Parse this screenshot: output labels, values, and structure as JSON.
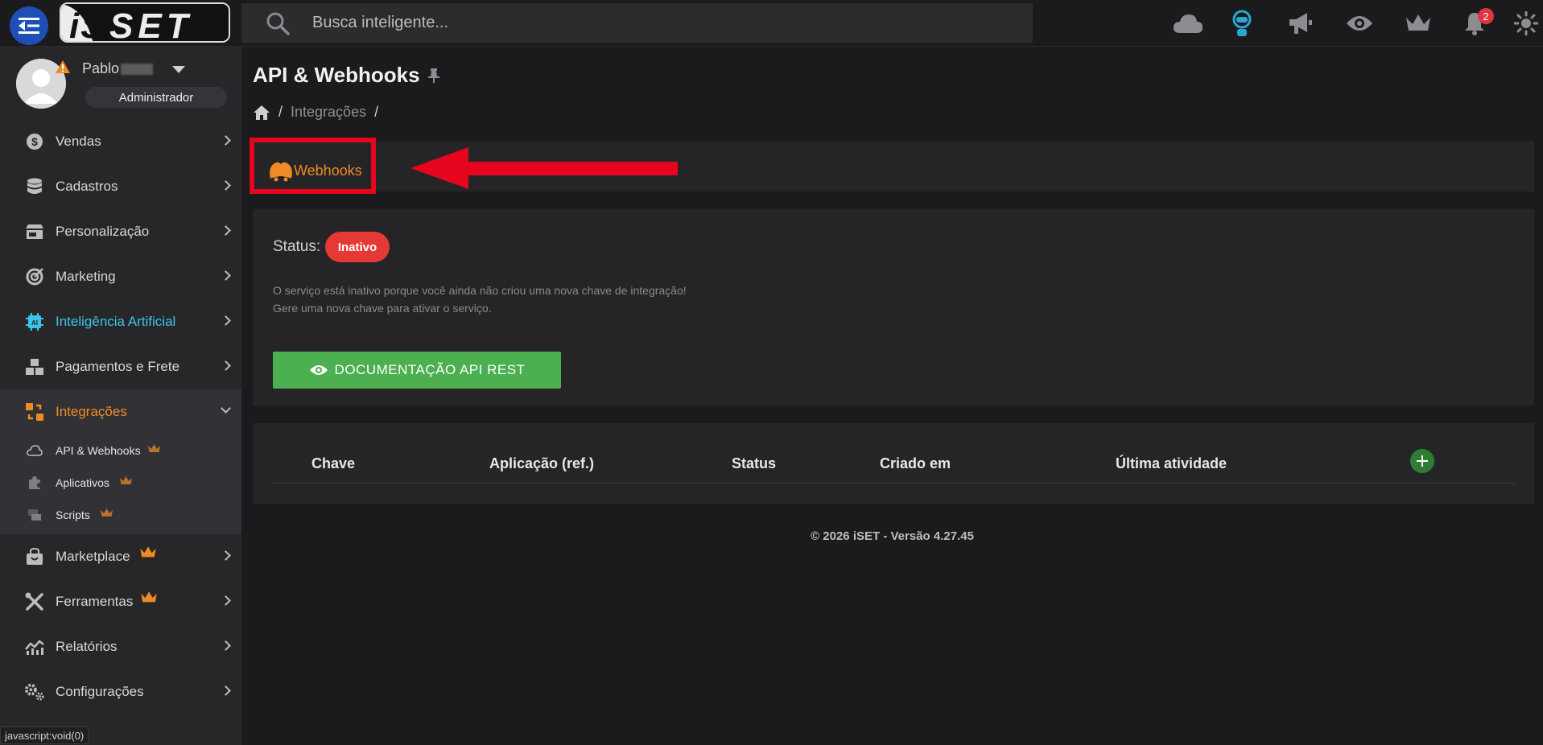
{
  "header": {
    "logo_text": "iSET",
    "search": {
      "placeholder": "Busca inteligente..."
    },
    "notifications_count": "2"
  },
  "user": {
    "name": "Pablo",
    "role": "Administrador"
  },
  "sidebar": {
    "items": [
      {
        "label": "Vendas",
        "icon": "dollar-icon"
      },
      {
        "label": "Cadastros",
        "icon": "database-icon"
      },
      {
        "label": "Personalização",
        "icon": "store-icon"
      },
      {
        "label": "Marketing",
        "icon": "target-icon"
      },
      {
        "label": "Inteligência Artificial",
        "icon": "ai-chip-icon"
      },
      {
        "label": "Pagamentos e Frete",
        "icon": "boxes-icon"
      },
      {
        "label": "Integrações",
        "icon": "integrations-icon"
      },
      {
        "label": "Marketplace",
        "icon": "marketplace-icon"
      },
      {
        "label": "Ferramentas",
        "icon": "tools-icon"
      },
      {
        "label": "Relatórios",
        "icon": "chart-icon"
      },
      {
        "label": "Configurações",
        "icon": "gears-icon"
      }
    ],
    "integracoes_sub": [
      {
        "label": "API & Webhooks",
        "icon": "cloud-icon"
      },
      {
        "label": "Aplicativos",
        "icon": "puzzle-icon"
      },
      {
        "label": "Scripts",
        "icon": "terminal-icon"
      }
    ]
  },
  "status_bar": {
    "text": "javascript:void(0)"
  },
  "page": {
    "title": "API & Webhooks",
    "breadcrumb": [
      "Integrações"
    ],
    "tab_label": "Webhooks",
    "status_label": "Status:",
    "status_value": "Inativo",
    "message_line1": "O serviço está inativo porque você ainda não criou uma nova chave de integração!",
    "message_line2": "Gere uma nova chave para ativar o serviço.",
    "doc_button": "DOCUMENTAÇÃO API REST"
  },
  "table": {
    "headers": [
      "Chave",
      "Aplicação (ref.)",
      "Status",
      "Criado em",
      "Última atividade"
    ]
  },
  "footer": {
    "text": "© 2026 iSET - Versão 4.27.45"
  },
  "colors": {
    "accent_orange": "#f08a24",
    "ai_cyan": "#3cc4e6",
    "status_red": "#e53935",
    "button_green": "#4caf50",
    "highlight_red": "#e6041e"
  }
}
